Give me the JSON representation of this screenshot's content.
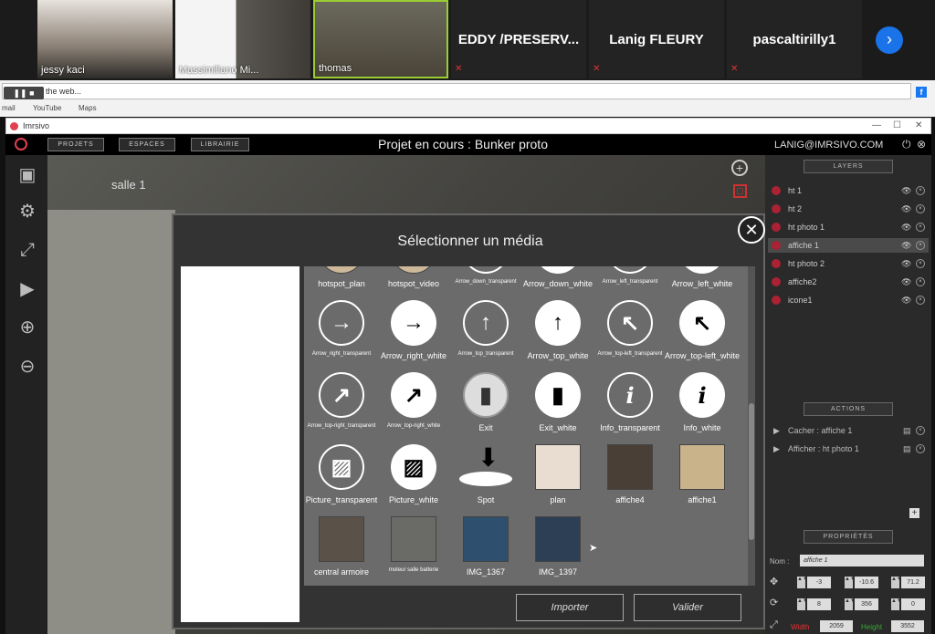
{
  "meeting": {
    "participants": [
      {
        "name": "jessy kaci"
      },
      {
        "name": "Massimiliano Mi..."
      },
      {
        "name": "thomas"
      }
    ],
    "text_tiles": [
      "EDDY /PRESERV...",
      "Lanig FLEURY",
      "pascaltirilly1"
    ]
  },
  "browser": {
    "address_placeholder": "Search the web...",
    "bookmarks": [
      "mail",
      "YouTube",
      "Maps"
    ]
  },
  "window": {
    "title": "Imrsivo"
  },
  "app": {
    "tabs": [
      "Projets",
      "Espaces",
      "Librairie"
    ],
    "project_title": "Projet en cours : Bunker proto",
    "user_email": "LANIG@IMRSIVO.COM",
    "scene_label": "salle 1"
  },
  "layers": {
    "header": "Layers",
    "items": [
      {
        "name": "ht 1",
        "selected": false
      },
      {
        "name": "ht 2",
        "selected": false
      },
      {
        "name": "ht photo 1",
        "selected": false
      },
      {
        "name": "affiche 1",
        "selected": true
      },
      {
        "name": "ht photo 2",
        "selected": false
      },
      {
        "name": "affiche2",
        "selected": false
      },
      {
        "name": "icone1",
        "selected": false
      }
    ]
  },
  "actions": {
    "header": "Actions",
    "items": [
      "Cacher : affiche 1",
      "Afficher : ht photo 1"
    ]
  },
  "properties": {
    "header": "Propriétés",
    "nom_label": "Nom :",
    "nom_value": "affiche 1",
    "position": {
      "x": "-3",
      "y": "-10.6",
      "z": "71.2"
    },
    "rotation": {
      "x": "8",
      "y": "356",
      "z": "0"
    },
    "width_label": "Width",
    "width": "2059",
    "height_label": "Height",
    "height": "3552"
  },
  "modal": {
    "title": "Sélectionner un média",
    "import_label": "Importer",
    "validate_label": "Valider",
    "media": [
      {
        "label": "hotspot_plan"
      },
      {
        "label": "hotspot_video"
      },
      {
        "label": "Arrow_down_transparent"
      },
      {
        "label": "Arrow_down_white"
      },
      {
        "label": "Arrow_left_transparent"
      },
      {
        "label": "Arrow_left_white"
      },
      {
        "label": "Arrow_right_transparent"
      },
      {
        "label": "Arrow_right_white"
      },
      {
        "label": "Arrow_top_transparent"
      },
      {
        "label": "Arrow_top_white"
      },
      {
        "label": "Arrow_top-left_transparent"
      },
      {
        "label": "Arrow_top-left_white"
      },
      {
        "label": "Arrow_top-right_transparent"
      },
      {
        "label": "Arrow_top-right_white"
      },
      {
        "label": "Exit"
      },
      {
        "label": "Exit_white"
      },
      {
        "label": "Info_transparent"
      },
      {
        "label": "Info_white"
      },
      {
        "label": "Picture_transparent"
      },
      {
        "label": "Picture_white"
      },
      {
        "label": "Spot"
      },
      {
        "label": "plan"
      },
      {
        "label": "affiche4"
      },
      {
        "label": "affiche1"
      },
      {
        "label": "central armoire"
      },
      {
        "label": "moteur salle batterie"
      },
      {
        "label": "IMG_1367"
      },
      {
        "label": "IMG_1397"
      }
    ]
  },
  "colors": {
    "accent": "#e0414f",
    "modal_bg": "#333333",
    "grid_bg": "#6b6b6b"
  }
}
